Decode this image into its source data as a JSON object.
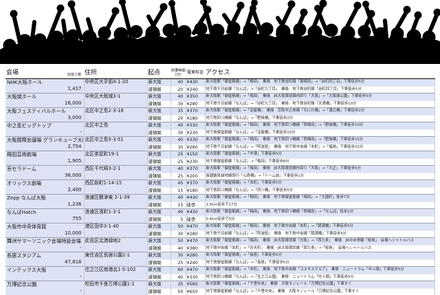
{
  "header": {
    "venue": "会場",
    "capacity": "収容人数",
    "address": "住所",
    "start": "起点",
    "time_top": "所要時間",
    "time_bottom": "(分)",
    "fare": "電車料金",
    "access": "アクセス"
  },
  "colors": {
    "row_blue": "#dde3f4",
    "silhouette": "#000000"
  },
  "venues": [
    {
      "name": "NHK大阪ホール",
      "capacity": "1,417",
      "address": "中央区大手前4-1-20",
      "routes": [
        {
          "from": "新大阪",
          "time": "40",
          "fare": "¥430",
          "access": "新大阪駅「御堂筋線」→「梅田」　乗換　地下鉄谷町線「東梅田」→「谷町四丁目」下車徒歩5分"
        },
        {
          "from": "道頓堀",
          "time": "20",
          "fare": "¥240",
          "access": "地下鉄千日前線「なんば」→「谷町九丁目」　乗換　地下鉄谷町線「谷町四丁目」下車徒歩5分"
        }
      ]
    },
    {
      "name": "大阪城ホール",
      "capacity": "16,000",
      "address": "中央区大阪城3-1",
      "routes": [
        {
          "from": "新大阪",
          "time": "40",
          "fare": "¥350",
          "access": "新大阪駅「御堂筋線」→「梅田」　乗換　JR大阪環状線内回り「大阪」→「大阪城公園」下車徒歩5分"
        },
        {
          "from": "道頓堀",
          "time": "30",
          "fare": "¥280",
          "access": "地下鉄千日前線「なんば」→「谷町九丁目」　乗換　地下鉄谷町線「天満橋」下車徒歩10分"
        }
      ]
    },
    {
      "name": "大阪フェスティバルホール",
      "capacity": "3,000",
      "address": "北区中之島2-3-18",
      "routes": [
        {
          "from": "新大阪",
          "time": "35",
          "fare": "¥370",
          "access": "新大阪駅「御堂筋線」→「淀屋橋」　乗換　京阪中之島線「なにわ橋」→「渡辺橋」下車徒歩2分"
        },
        {
          "from": "道頓堀",
          "time": "20",
          "fare": "¥180",
          "access": "地下鉄四つ橋線「なんば」→「肥後橋」下車徒歩2分"
        }
      ]
    },
    {
      "name": "中之島ビッグトップ",
      "capacity": "-",
      "address": "北区中之島",
      "routes": [
        {
          "from": "新大阪",
          "time": "40",
          "fare": "¥330",
          "access": "新大阪駅「御堂筋線」→「梅田」　乗換　地下鉄四つ橋線「西梅田」→「肥後橋」下車徒歩10分"
        },
        {
          "from": "道頓堀",
          "time": "30",
          "fare": "¥230",
          "access": "地下鉄御堂筋線「なんば」→「淀屋橋」下車徒歩10分"
        }
      ]
    },
    {
      "name": "大阪国際会議場 グランキューブ大阪",
      "capacity": "2,754",
      "address": "北区中之島5-3-51",
      "routes": [
        {
          "from": "新大阪",
          "time": "40",
          "fare": "¥330",
          "access": "新大阪駅「御堂筋線」→「梅田」　乗換　地下鉄四つ橋線「西梅田」→「肥後橋」下車徒歩15分"
        },
        {
          "from": "道頓堀",
          "time": "30",
          "fare": "¥280",
          "access": "地下鉄千日前線「なんば」→「阿波座」　乗換　地下鉄中央線「本町」→「福島」下車徒歩15分"
        }
      ]
    },
    {
      "name": "梅田芸術劇場",
      "capacity": "1,905",
      "address": "北区茶屋町19-1",
      "routes": [
        {
          "from": "新大阪",
          "time": "25",
          "fare": "¥150",
          "access": "新大阪駅「御堂筋線」→「中津」下車徒歩5分"
        },
        {
          "from": "道頓堀",
          "time": "25",
          "fare": "¥230",
          "access": "地下鉄御堂筋線「なんば」→「梅田」下車徒歩8分"
        }
      ]
    },
    {
      "name": "京セラドーム",
      "capacity": "36,000",
      "address": "西区千代崎3-2-1",
      "routes": [
        {
          "from": "新大阪",
          "time": "40",
          "fare": "¥370",
          "access": "新大阪駅「御堂筋線」→「梅田」　乗換　JR大阪環状線外回り「大阪」→「大正」下車徒歩5分"
        },
        {
          "from": "道頓堀",
          "time": "25",
          "fare": "¥200",
          "access": "長堀鶴見緑地線西行「心斎橋」→「ドーム前」下車徒歩1分"
        }
      ]
    },
    {
      "name": "オリックス劇場",
      "capacity": "2,400",
      "address": "西区新町1-14-15",
      "routes": [
        {
          "from": "新大阪",
          "time": "45",
          "fare": "¥370",
          "access": "新大阪駅「御堂筋線」→「本町」下車徒歩5分"
        },
        {
          "from": "道頓堀",
          "time": "15",
          "fare": "¥180",
          "access": "地下鉄四つ橋線「なんば」→「四ツ橋」下車徒歩5分"
        }
      ]
    },
    {
      "name": "Zepp なんば大阪",
      "capacity": "1,236",
      "address": "浪速区敷津東 2-1-39",
      "routes": [
        {
          "from": "新大阪",
          "time": "40",
          "fare": "¥430",
          "access": "新大阪駅「御堂筋線」→「梅田」　乗換　地下鉄御堂筋線「梅田」→「大国町」徒歩7分"
        },
        {
          "from": "道頓堀",
          "time": "15",
          "fare": "徒歩",
          "access": "1.5km徒歩で17分"
        }
      ]
    },
    {
      "name": "なんばHatch",
      "capacity": "755",
      "address": "浪速区湊町1-3-1",
      "routes": [
        {
          "from": "新大阪",
          "time": "40",
          "fare": "¥430",
          "access": "新大阪駅「御堂筋線」→「梅田」　乗換　地下鉄四つ橋線「西梅田」→「なんば」徒歩2分"
        },
        {
          "from": "道頓堀",
          "time": "5",
          "fare": "徒歩",
          "access": "0.4km徒歩で5分"
        }
      ]
    },
    {
      "name": "大阪市中央体育館",
      "capacity": "10,000",
      "address": "港区田中3-1-40",
      "routes": [
        {
          "from": "新大阪",
          "time": "50",
          "fare": "¥470",
          "access": "新大阪駅「御堂筋線」→「梅田」　乗換　地下鉄中央線「本町」→「朝潮橋」下車徒歩5分"
        },
        {
          "from": "道頓堀",
          "time": "30",
          "fare": "¥280",
          "access": "地下鉄千日前線「なんば」→「阿波座」　乗換　地下鉄中央線「朝潮橋」下車徒歩5分"
        }
      ]
    },
    {
      "name": "舞洲サマーソニック会場特設会場",
      "capacity": "-",
      "address": "此花区北港緑地2",
      "routes": [
        {
          "from": "新大阪",
          "time": "50",
          "fare": "¥470",
          "access": "新大阪駅「御堂筋線」→「梅田」　乗換　JR大阪環状線「大阪」→「西九条」　乗換　JRゆめ咲線「桜島」　会場へシャトルバス"
        },
        {
          "from": "道頓堀",
          "time": "40",
          "fare": "¥380",
          "access": "地下鉄中央線「本町」→「弁天町」　乗換　JR大阪環状線「西九条」→「桜島」　会場へシャトルバス"
        }
      ]
    },
    {
      "name": "長居スタジアム",
      "capacity": "47,816",
      "address": "東住吉区長居公園1-1",
      "routes": [
        {
          "from": "新大阪",
          "time": "30",
          "fare": "¥280",
          "access": "新大阪駅「御堂筋線」→「長居」下車徒歩5分"
        },
        {
          "from": "道頓堀",
          "time": "25",
          "fare": "¥240",
          "access": "地下鉄御堂筋線「なんば」→「長居」下車徒歩5分"
        }
      ]
    },
    {
      "name": "インテックス大阪",
      "capacity": "-",
      "address": "住之江区南港北1-5-102",
      "routes": [
        {
          "from": "新大阪",
          "time": "60",
          "fare": "¥470",
          "access": "新大阪駅「御堂筋線」→「本町」　乗換　地下鉄中央線「コスモスクエア」　乗換　ニュートラム「中ふ頭」下車徒歩5分"
        },
        {
          "from": "道頓堀",
          "time": "40",
          "fare": "¥330",
          "access": "地下鉄四つ橋線「なんば」→「住之江公園」　乗換　ニュートラム「中ふ頭」下車徒歩5分"
        }
      ]
    },
    {
      "name": "万博記念公園",
      "capacity": "-",
      "address": "吹田市千里万博公園1-1",
      "routes": [
        {
          "from": "新大阪",
          "time": "35",
          "fare": "¥560",
          "access": "新大阪駅「御堂筋線」→「千里中央」　乗換　大阪モノレール「万博記念公園」下車すぐ"
        },
        {
          "from": "道頓堀",
          "time": "50",
          "fare": "¥650",
          "access": "地下鉄御堂筋線「なんば」→「千里中央」　乗換　大阪モノレール「万博記念公園」下車すぐ"
        }
      ]
    }
  ]
}
